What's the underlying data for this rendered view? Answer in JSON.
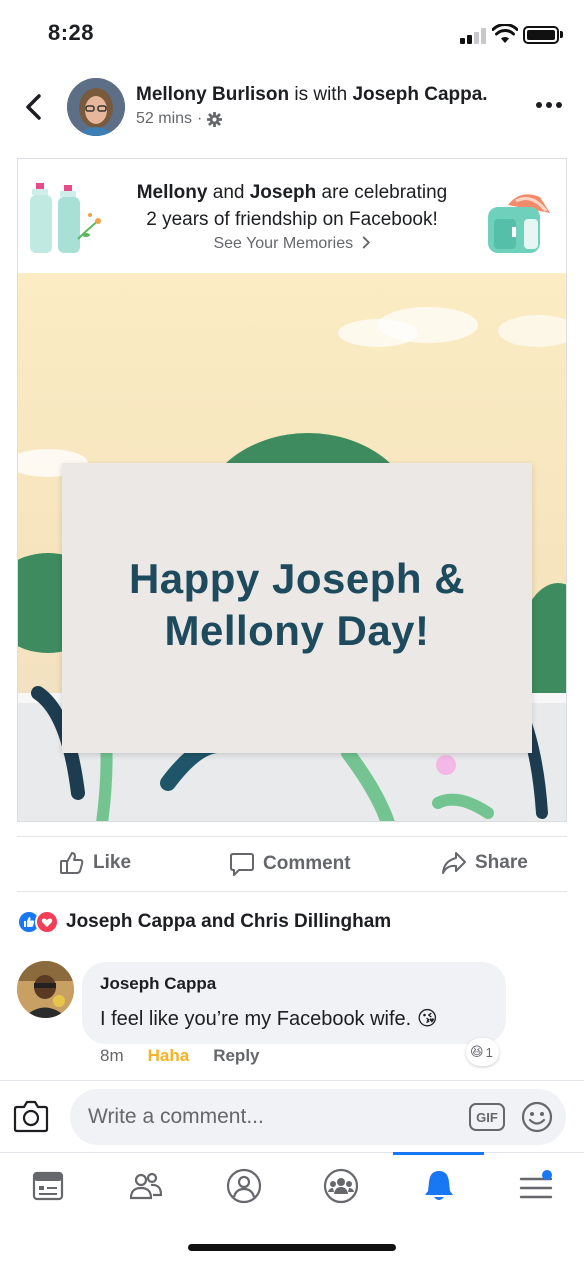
{
  "status_bar": {
    "time": "8:28"
  },
  "header": {
    "author": "Mellony Burlison",
    "connector": "is with",
    "tagged": "Joseph Cappa.",
    "time_ago": "52 mins",
    "separator": "·"
  },
  "memory_card": {
    "name1": "Mellony",
    "and": "and",
    "name2": "Joseph",
    "line1_rest": "are celebrating",
    "line2": "2 years of friendship on Facebook!",
    "link": "See Your Memories"
  },
  "image_card": {
    "line1": "Happy Joseph &",
    "line2": "Mellony Day!"
  },
  "actions": {
    "like": "Like",
    "comment": "Comment",
    "share": "Share"
  },
  "reactions": {
    "names": "Joseph Cappa and Chris Dillingham"
  },
  "comment": {
    "author": "Joseph Cappa",
    "text": "I feel like you’re my Facebook wife.",
    "emoji": "😘",
    "time": "8m",
    "haha": "Haha",
    "reply": "Reply",
    "reaction_emoji": "😆",
    "reaction_count": "1"
  },
  "composer": {
    "placeholder": "Write a comment...",
    "gif": "GIF"
  },
  "tabs": [
    "feed",
    "friends",
    "profile",
    "groups",
    "notifications",
    "menu"
  ],
  "colors": {
    "accent": "#1877f2",
    "haha": "#f7b125",
    "love": "#f33e58",
    "sign_text": "#1d4a5d"
  }
}
